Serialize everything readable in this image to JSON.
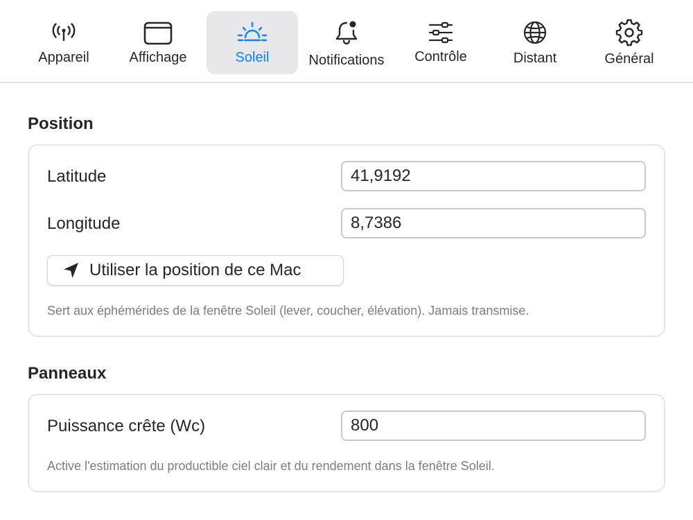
{
  "toolbar": {
    "tabs": [
      {
        "label": "Appareil",
        "icon": "antenna-icon",
        "active": false
      },
      {
        "label": "Affichage",
        "icon": "window-icon",
        "active": false
      },
      {
        "label": "Soleil",
        "icon": "sunrise-icon",
        "active": true
      },
      {
        "label": "Notifications",
        "icon": "bell-badge-icon",
        "active": false
      },
      {
        "label": "Contrôle",
        "icon": "sliders-icon",
        "active": false
      },
      {
        "label": "Distant",
        "icon": "globe-icon",
        "active": false
      },
      {
        "label": "Général",
        "icon": "gear-icon",
        "active": false
      }
    ]
  },
  "position": {
    "title": "Position",
    "latitude_label": "Latitude",
    "latitude_value": "41,9192",
    "longitude_label": "Longitude",
    "longitude_value": "8,7386",
    "use_location_label": "Utiliser la position de ce Mac",
    "use_location_icon": "location-arrow-icon",
    "help": "Sert aux éphémérides de la fenêtre Soleil (lever, coucher, élévation). Jamais transmise."
  },
  "panels": {
    "title": "Panneaux",
    "peak_power_label": "Puissance crête (Wc)",
    "peak_power_value": "800",
    "help": "Active l'estimation du productible ciel clair et du rendement dans la fenêtre Soleil."
  },
  "colors": {
    "accent": "#0a84ff",
    "active_tab_bg": "#e8e8ea",
    "help_text": "#7d7d7d"
  }
}
